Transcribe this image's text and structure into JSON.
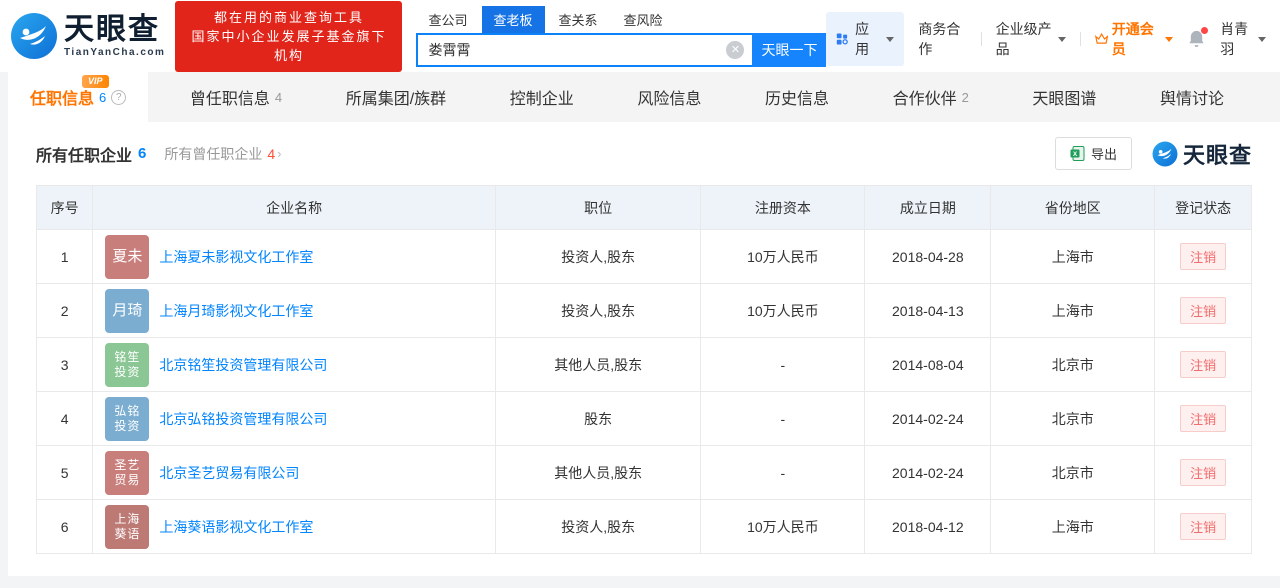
{
  "header": {
    "logo": {
      "brand": "天眼查",
      "domain": "TianYanCha.com"
    },
    "banner": {
      "line1": "都在用的商业查询工具",
      "line2": "国家中小企业发展子基金旗下机构"
    },
    "search": {
      "tabs": {
        "company": "查公司",
        "boss": "查老板",
        "relation": "查关系",
        "risk": "查风险"
      },
      "value": "娄霄霄",
      "button": "天眼一下",
      "clear_icon": "clear-circle-x"
    },
    "nav": {
      "apps": "应用",
      "biz_coop": "商务合作",
      "enterprise": "企业级产品",
      "vip": "开通会员",
      "user": "肖青羽"
    }
  },
  "tabs": {
    "t0": {
      "label": "任职信息",
      "count": "6",
      "vip": "VIP",
      "help": "?"
    },
    "t1": {
      "label": "曾任职信息",
      "count": "4"
    },
    "t2": {
      "label": "所属集团/族群"
    },
    "t3": {
      "label": "控制企业"
    },
    "t4": {
      "label": "风险信息"
    },
    "t5": {
      "label": "历史信息"
    },
    "t6": {
      "label": "合作伙伴",
      "count": "2"
    },
    "t7": {
      "label": "天眼图谱"
    },
    "t8": {
      "label": "舆情讨论"
    }
  },
  "section": {
    "title": "所有任职企业",
    "title_count": "6",
    "subtitle": "所有曾任职企业",
    "subtitle_count": "4",
    "arrow": "›",
    "export_label": "导出",
    "watermark": "天眼查"
  },
  "table": {
    "headers": {
      "no": "序号",
      "company": "企业名称",
      "position": "职位",
      "capital": "注册资本",
      "date": "成立日期",
      "region": "省份地区",
      "status": "登记状态"
    },
    "rows": [
      {
        "no": "1",
        "logo_line1": "夏未",
        "logo_color": "#c87f7c",
        "company": "上海夏未影视文化工作室",
        "position": "投资人,股东",
        "capital": "10万人民币",
        "date": "2018-04-28",
        "region": "上海市",
        "status": "注销"
      },
      {
        "no": "2",
        "logo_line1": "月琦",
        "logo_color": "#7badd1",
        "company": "上海月琦影视文化工作室",
        "position": "投资人,股东",
        "capital": "10万人民币",
        "date": "2018-04-13",
        "region": "上海市",
        "status": "注销"
      },
      {
        "no": "3",
        "logo_line1": "铭笙",
        "logo_line2": "投资",
        "logo_color": "#8bc795",
        "company": "北京铭笙投资管理有限公司",
        "position": "其他人员,股东",
        "capital": "-",
        "date": "2014-08-04",
        "region": "北京市",
        "status": "注销"
      },
      {
        "no": "4",
        "logo_line1": "弘铭",
        "logo_line2": "投资",
        "logo_color": "#7badd1",
        "company": "北京弘铭投资管理有限公司",
        "position": "股东",
        "capital": "-",
        "date": "2014-02-24",
        "region": "北京市",
        "status": "注销"
      },
      {
        "no": "5",
        "logo_line1": "圣艺",
        "logo_line2": "贸易",
        "logo_color": "#c87f7c",
        "company": "北京圣艺贸易有限公司",
        "position": "其他人员,股东",
        "capital": "-",
        "date": "2014-02-24",
        "region": "北京市",
        "status": "注销"
      },
      {
        "no": "6",
        "logo_line1": "上海",
        "logo_line2": "葵语",
        "logo_color": "#bd7a75",
        "company": "上海葵语影视文化工作室",
        "position": "投资人,股东",
        "capital": "10万人民币",
        "date": "2018-04-12",
        "region": "上海市",
        "status": "注销"
      }
    ]
  },
  "colors": {
    "accent_blue": "#0084ff",
    "accent_orange": "#ff7500",
    "banner_red": "#e1251b",
    "status_red": "#f26d6d"
  }
}
